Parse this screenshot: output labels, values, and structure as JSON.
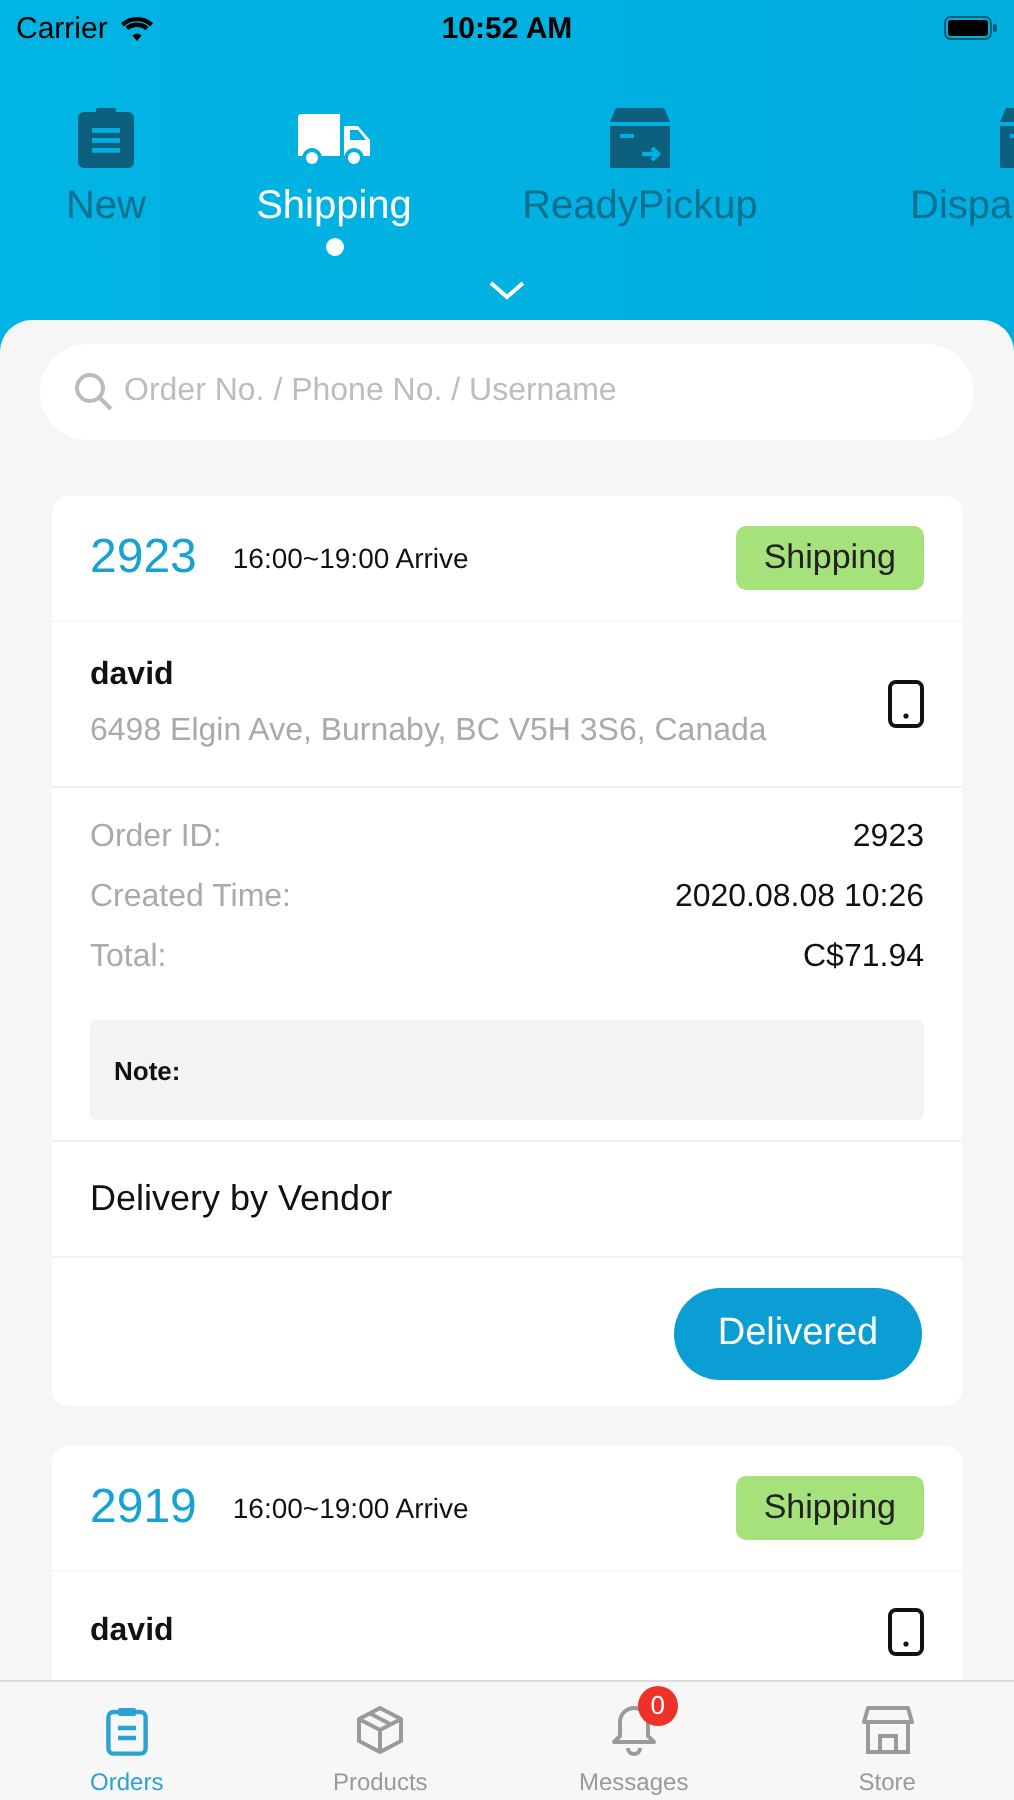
{
  "status_bar": {
    "carrier": "Carrier",
    "time": "10:52 AM"
  },
  "order_tabs": [
    {
      "label": "New",
      "selected": false
    },
    {
      "label": "Shipping",
      "selected": true
    },
    {
      "label": "ReadyPickup",
      "selected": false
    },
    {
      "label": "Dispa",
      "selected": false
    }
  ],
  "search": {
    "placeholder": "Order No. / Phone No. / Username"
  },
  "orders": [
    {
      "number": "2923",
      "arrival": "16:00~19:00 Arrive",
      "status": "Shipping",
      "customer": "david",
      "address": "6498 Elgin Ave, Burnaby, BC V5H 3S6, Canada",
      "details": [
        {
          "label": "Order ID:",
          "value": "2923"
        },
        {
          "label": "Created Time:",
          "value": "2020.08.08 10:26"
        },
        {
          "label": "Total:",
          "value": "C$71.94"
        }
      ],
      "note_label": "Note:",
      "delivery": "Delivery by Vendor",
      "action": "Delivered"
    },
    {
      "number": "2919",
      "arrival": "16:00~19:00 Arrive",
      "status": "Shipping",
      "customer": "david"
    }
  ],
  "bottom_tabs": [
    {
      "label": "Orders",
      "selected": true
    },
    {
      "label": "Products",
      "selected": false
    },
    {
      "label": "Messages",
      "selected": false,
      "badge": "0"
    },
    {
      "label": "Store",
      "selected": false
    }
  ]
}
